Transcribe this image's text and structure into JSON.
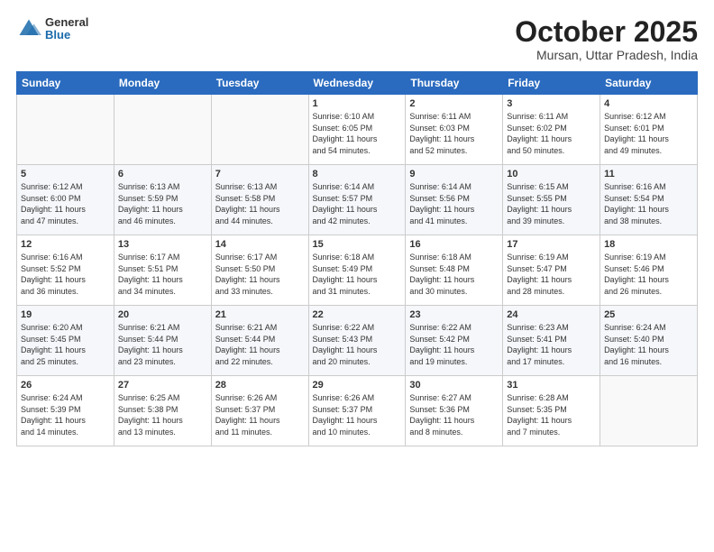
{
  "header": {
    "logo_general": "General",
    "logo_blue": "Blue",
    "month_title": "October 2025",
    "location": "Mursan, Uttar Pradesh, India"
  },
  "calendar": {
    "days_of_week": [
      "Sunday",
      "Monday",
      "Tuesday",
      "Wednesday",
      "Thursday",
      "Friday",
      "Saturday"
    ],
    "weeks": [
      [
        {
          "day": "",
          "info": ""
        },
        {
          "day": "",
          "info": ""
        },
        {
          "day": "",
          "info": ""
        },
        {
          "day": "1",
          "info": "Sunrise: 6:10 AM\nSunset: 6:05 PM\nDaylight: 11 hours\nand 54 minutes."
        },
        {
          "day": "2",
          "info": "Sunrise: 6:11 AM\nSunset: 6:03 PM\nDaylight: 11 hours\nand 52 minutes."
        },
        {
          "day": "3",
          "info": "Sunrise: 6:11 AM\nSunset: 6:02 PM\nDaylight: 11 hours\nand 50 minutes."
        },
        {
          "day": "4",
          "info": "Sunrise: 6:12 AM\nSunset: 6:01 PM\nDaylight: 11 hours\nand 49 minutes."
        }
      ],
      [
        {
          "day": "5",
          "info": "Sunrise: 6:12 AM\nSunset: 6:00 PM\nDaylight: 11 hours\nand 47 minutes."
        },
        {
          "day": "6",
          "info": "Sunrise: 6:13 AM\nSunset: 5:59 PM\nDaylight: 11 hours\nand 46 minutes."
        },
        {
          "day": "7",
          "info": "Sunrise: 6:13 AM\nSunset: 5:58 PM\nDaylight: 11 hours\nand 44 minutes."
        },
        {
          "day": "8",
          "info": "Sunrise: 6:14 AM\nSunset: 5:57 PM\nDaylight: 11 hours\nand 42 minutes."
        },
        {
          "day": "9",
          "info": "Sunrise: 6:14 AM\nSunset: 5:56 PM\nDaylight: 11 hours\nand 41 minutes."
        },
        {
          "day": "10",
          "info": "Sunrise: 6:15 AM\nSunset: 5:55 PM\nDaylight: 11 hours\nand 39 minutes."
        },
        {
          "day": "11",
          "info": "Sunrise: 6:16 AM\nSunset: 5:54 PM\nDaylight: 11 hours\nand 38 minutes."
        }
      ],
      [
        {
          "day": "12",
          "info": "Sunrise: 6:16 AM\nSunset: 5:52 PM\nDaylight: 11 hours\nand 36 minutes."
        },
        {
          "day": "13",
          "info": "Sunrise: 6:17 AM\nSunset: 5:51 PM\nDaylight: 11 hours\nand 34 minutes."
        },
        {
          "day": "14",
          "info": "Sunrise: 6:17 AM\nSunset: 5:50 PM\nDaylight: 11 hours\nand 33 minutes."
        },
        {
          "day": "15",
          "info": "Sunrise: 6:18 AM\nSunset: 5:49 PM\nDaylight: 11 hours\nand 31 minutes."
        },
        {
          "day": "16",
          "info": "Sunrise: 6:18 AM\nSunset: 5:48 PM\nDaylight: 11 hours\nand 30 minutes."
        },
        {
          "day": "17",
          "info": "Sunrise: 6:19 AM\nSunset: 5:47 PM\nDaylight: 11 hours\nand 28 minutes."
        },
        {
          "day": "18",
          "info": "Sunrise: 6:19 AM\nSunset: 5:46 PM\nDaylight: 11 hours\nand 26 minutes."
        }
      ],
      [
        {
          "day": "19",
          "info": "Sunrise: 6:20 AM\nSunset: 5:45 PM\nDaylight: 11 hours\nand 25 minutes."
        },
        {
          "day": "20",
          "info": "Sunrise: 6:21 AM\nSunset: 5:44 PM\nDaylight: 11 hours\nand 23 minutes."
        },
        {
          "day": "21",
          "info": "Sunrise: 6:21 AM\nSunset: 5:44 PM\nDaylight: 11 hours\nand 22 minutes."
        },
        {
          "day": "22",
          "info": "Sunrise: 6:22 AM\nSunset: 5:43 PM\nDaylight: 11 hours\nand 20 minutes."
        },
        {
          "day": "23",
          "info": "Sunrise: 6:22 AM\nSunset: 5:42 PM\nDaylight: 11 hours\nand 19 minutes."
        },
        {
          "day": "24",
          "info": "Sunrise: 6:23 AM\nSunset: 5:41 PM\nDaylight: 11 hours\nand 17 minutes."
        },
        {
          "day": "25",
          "info": "Sunrise: 6:24 AM\nSunset: 5:40 PM\nDaylight: 11 hours\nand 16 minutes."
        }
      ],
      [
        {
          "day": "26",
          "info": "Sunrise: 6:24 AM\nSunset: 5:39 PM\nDaylight: 11 hours\nand 14 minutes."
        },
        {
          "day": "27",
          "info": "Sunrise: 6:25 AM\nSunset: 5:38 PM\nDaylight: 11 hours\nand 13 minutes."
        },
        {
          "day": "28",
          "info": "Sunrise: 6:26 AM\nSunset: 5:37 PM\nDaylight: 11 hours\nand 11 minutes."
        },
        {
          "day": "29",
          "info": "Sunrise: 6:26 AM\nSunset: 5:37 PM\nDaylight: 11 hours\nand 10 minutes."
        },
        {
          "day": "30",
          "info": "Sunrise: 6:27 AM\nSunset: 5:36 PM\nDaylight: 11 hours\nand 8 minutes."
        },
        {
          "day": "31",
          "info": "Sunrise: 6:28 AM\nSunset: 5:35 PM\nDaylight: 11 hours\nand 7 minutes."
        },
        {
          "day": "",
          "info": ""
        }
      ]
    ]
  }
}
